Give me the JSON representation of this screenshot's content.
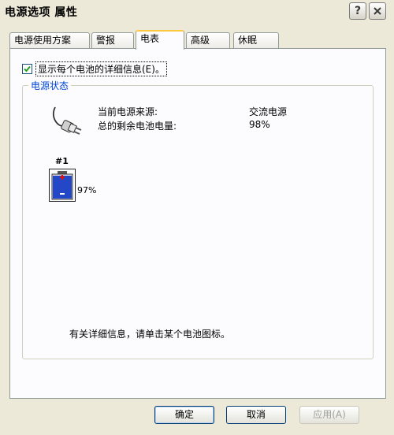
{
  "window": {
    "title": "电源选项 属性",
    "help_icon": "question-icon",
    "close_icon": "close-icon"
  },
  "tabs": [
    {
      "label": "电源使用方案"
    },
    {
      "label": "警报"
    },
    {
      "label": "电表",
      "active": true
    },
    {
      "label": "高级"
    },
    {
      "label": "休眠"
    }
  ],
  "details_checkbox": {
    "label": "显示每个电池的详细信息(E)。",
    "checked": true
  },
  "power_status": {
    "group_label": "电源状态",
    "source_label": "当前电源来源:",
    "source_value": "交流电源",
    "remaining_label": "总的剩余电池电量:",
    "remaining_value": "98%",
    "battery": {
      "number": "#1",
      "percent_text": "97%",
      "level": 0.97,
      "icon": "battery-charging-icon"
    },
    "info_text": "有关详细信息，请单击某个电池图标。"
  },
  "buttons": {
    "ok": "确定",
    "cancel": "取消",
    "apply": "应用(A)"
  },
  "colors": {
    "group_label": "#0046d5",
    "active_tab_accent": "#ffc83c",
    "battery_fill": "#2447c7"
  }
}
